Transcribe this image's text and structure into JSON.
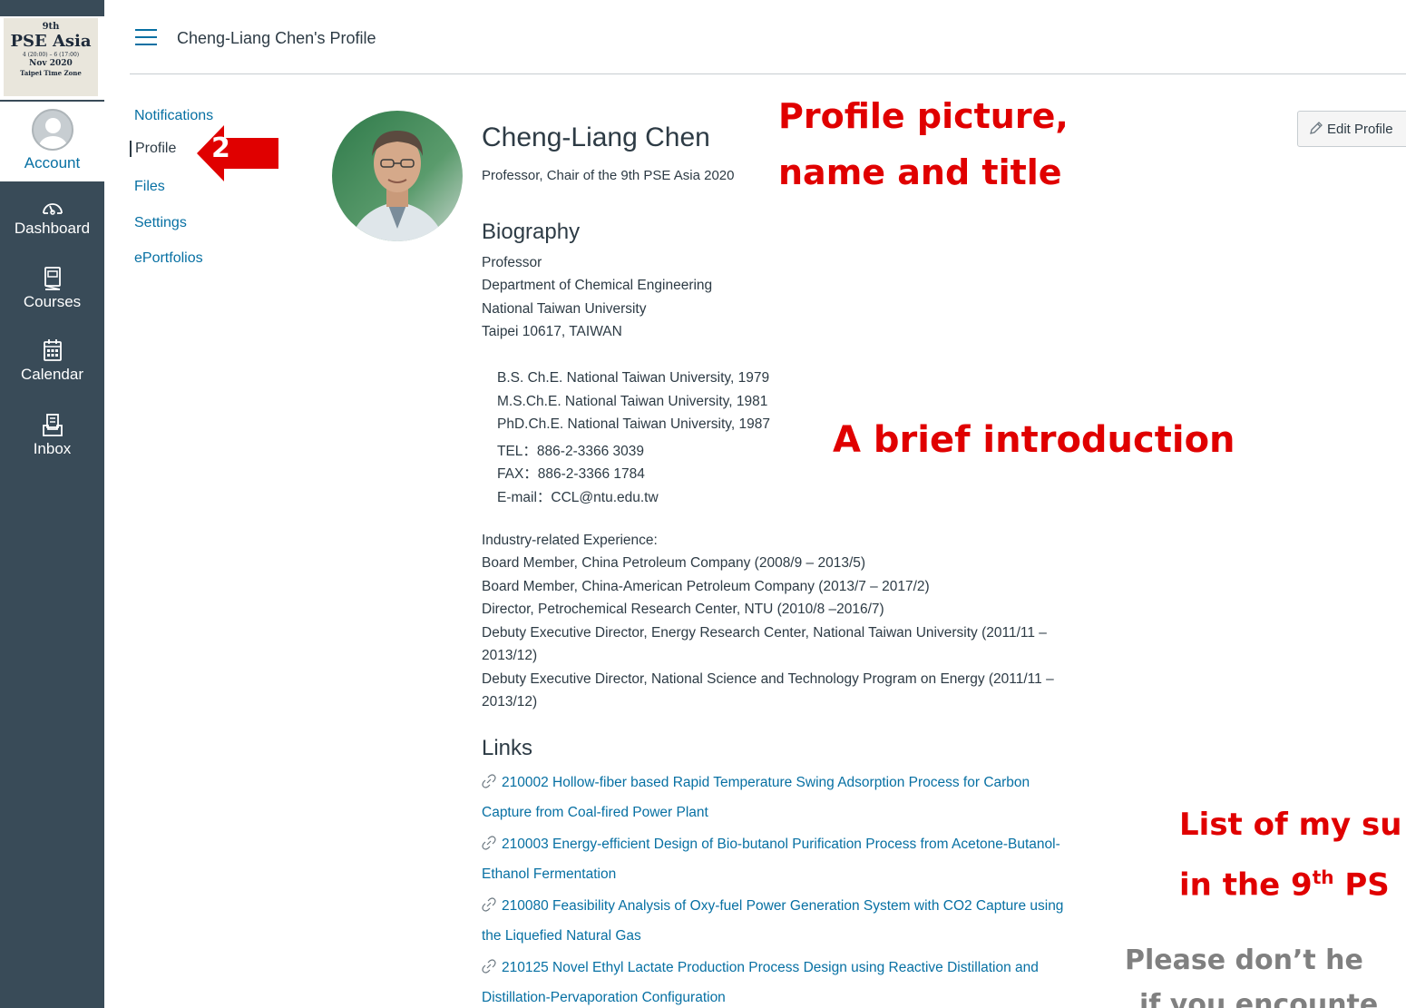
{
  "logo": {
    "line1": "9th",
    "line2": "PSE Asia",
    "line3": "4 (20:00) – 6 (17:00)",
    "line4": "Nov 2020",
    "line5": "Taipei Time Zone"
  },
  "global_nav": {
    "account": "Account",
    "dashboard": "Dashboard",
    "courses": "Courses",
    "calendar": "Calendar",
    "inbox": "Inbox"
  },
  "header": {
    "title": "Cheng-Liang Chen's Profile"
  },
  "left_menu": {
    "notifications": "Notifications",
    "profile": "Profile",
    "files": "Files",
    "settings": "Settings",
    "eportfolios": "ePortfolios"
  },
  "profile": {
    "name": "Cheng-Liang Chen",
    "title": "Professor, Chair of the 9th PSE Asia 2020",
    "edit_label": "Edit Profile",
    "biography_heading": "Biography",
    "bio_address": [
      "Professor",
      "Department of Chemical Engineering",
      "National Taiwan University",
      "Taipei 10617, TAIWAN"
    ],
    "bio_education": [
      "B.S. Ch.E. National Taiwan University, 1979",
      "M.S.Ch.E. National Taiwan University, 1981",
      "PhD.Ch.E. National Taiwan University, 1987",
      "TEL：886-2-3366 3039",
      "FAX：886-2-3366 1784",
      "E-mail：CCL@ntu.edu.tw"
    ],
    "bio_experience": [
      "Industry-related Experience:",
      "Board Member, China Petroleum Company (2008/9 – 2013/5)",
      "Board Member, China-American Petroleum Company (2013/7 – 2017/2)",
      "Director, Petrochemical Research Center, NTU (2010/8 –2016/7)",
      "Debuty Executive Director, Energy Research Center, National Taiwan University (2011/11 –",
      "2013/12)",
      "Debuty Executive Director, National Science and Technology Program on Energy (2011/11 –",
      "2013/12)"
    ],
    "links_heading": "Links",
    "links": [
      {
        "line1": "210002 Hollow-fiber based Rapid Temperature Swing Adsorption Process for Carbon",
        "line2": "Capture from Coal-fired Power Plant"
      },
      {
        "line1": "210003 Energy-efficient Design of Bio-butanol Purification Process from Acetone-Butanol-",
        "line2": "Ethanol Fermentation"
      },
      {
        "line1": "210080 Feasibility Analysis of Oxy-fuel Power Generation System with CO2 Capture using",
        "line2": "the Liquefied Natural Gas"
      },
      {
        "line1": "210125 Novel Ethyl Lactate Production Process Design using Reactive Distillation and",
        "line2": "Distillation-Pervaporation Configuration"
      }
    ]
  },
  "annotations": {
    "step_number": "2",
    "profile_note_1": "Profile picture,",
    "profile_note_2": "name and title",
    "intro_note": "A brief introduction",
    "list_note_1": "List of my su",
    "list_note_2_a": "in the 9",
    "list_note_2_sup": "th",
    "list_note_2_b": " PS",
    "help_note_1": "Please don’t he",
    "help_note_2": "if you encounte"
  },
  "colors": {
    "nav_bg": "#394b58",
    "link": "#0770a3",
    "text": "#2d3b45",
    "annotation": "#e00000"
  }
}
